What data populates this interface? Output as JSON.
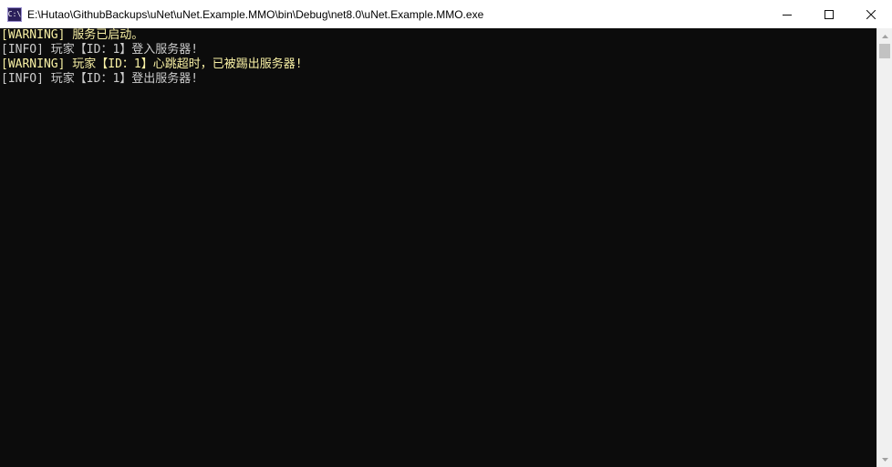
{
  "window": {
    "title": "E:\\Hutao\\GithubBackups\\uNet\\uNet.Example.MMO\\bin\\Debug\\net8.0\\uNet.Example.MMO.exe",
    "app_icon_text": "C:\\"
  },
  "colors": {
    "warning": "#f9f1a5",
    "info": "#cccccc",
    "background": "#0c0c0c"
  },
  "console": {
    "lines": [
      {
        "text": "[WARNING] 服务已启动。",
        "level": "warning"
      },
      {
        "text": "[INFO] 玩家【ID：1】登入服务器!",
        "level": "info"
      },
      {
        "text": "[WARNING] 玩家【ID：1】心跳超时，已被踢出服务器!",
        "level": "warning"
      },
      {
        "text": "[INFO] 玩家【ID：1】登出服务器!",
        "level": "info"
      }
    ]
  }
}
